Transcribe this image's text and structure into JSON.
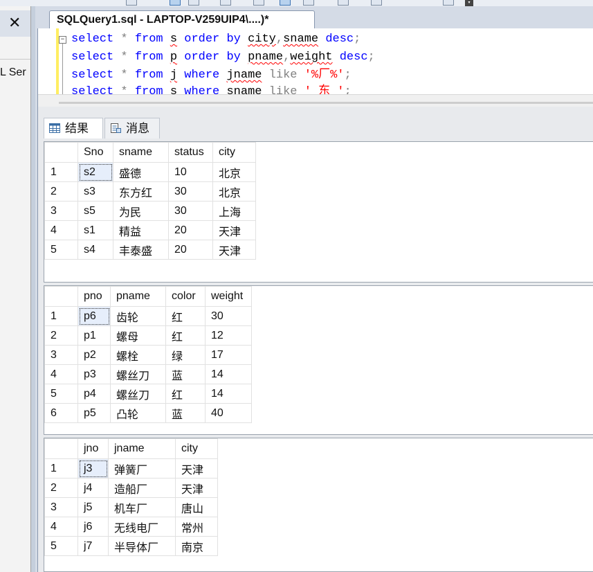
{
  "document": {
    "tab_title": "SQLQuery1.sql - LAPTOP-V259UIP4\\....)*"
  },
  "left_panel": {
    "close_glyph": "✕",
    "label": "L Ser"
  },
  "editor": {
    "fold_glyph": "−",
    "lines": [
      [
        {
          "t": "select",
          "c": "kw"
        },
        {
          "t": " ",
          "c": ""
        },
        {
          "t": "*",
          "c": "op"
        },
        {
          "t": " ",
          "c": ""
        },
        {
          "t": "from",
          "c": "kw"
        },
        {
          "t": " ",
          "c": ""
        },
        {
          "t": "s",
          "c": "sq"
        },
        {
          "t": " ",
          "c": ""
        },
        {
          "t": "order by",
          "c": "kw"
        },
        {
          "t": " ",
          "c": ""
        },
        {
          "t": "city",
          "c": "sq"
        },
        {
          "t": ",",
          "c": "op"
        },
        {
          "t": "sname",
          "c": "sq"
        },
        {
          "t": " ",
          "c": ""
        },
        {
          "t": "desc",
          "c": "kw"
        },
        {
          "t": ";",
          "c": "op"
        }
      ],
      [
        {
          "t": "select",
          "c": "kw"
        },
        {
          "t": " ",
          "c": ""
        },
        {
          "t": "*",
          "c": "op"
        },
        {
          "t": " ",
          "c": ""
        },
        {
          "t": "from",
          "c": "kw"
        },
        {
          "t": " ",
          "c": ""
        },
        {
          "t": "p",
          "c": "sq"
        },
        {
          "t": " ",
          "c": ""
        },
        {
          "t": "order by",
          "c": "kw"
        },
        {
          "t": " ",
          "c": ""
        },
        {
          "t": "pname",
          "c": "sq"
        },
        {
          "t": ",",
          "c": "op"
        },
        {
          "t": "weight",
          "c": "sq"
        },
        {
          "t": " ",
          "c": ""
        },
        {
          "t": "desc",
          "c": "kw"
        },
        {
          "t": ";",
          "c": "op"
        }
      ],
      [
        {
          "t": "select",
          "c": "kw"
        },
        {
          "t": " ",
          "c": ""
        },
        {
          "t": "*",
          "c": "op"
        },
        {
          "t": " ",
          "c": ""
        },
        {
          "t": "from",
          "c": "kw"
        },
        {
          "t": " ",
          "c": ""
        },
        {
          "t": "j",
          "c": "sq"
        },
        {
          "t": " ",
          "c": ""
        },
        {
          "t": "where",
          "c": "kw"
        },
        {
          "t": " ",
          "c": ""
        },
        {
          "t": "jname",
          "c": "sq"
        },
        {
          "t": " ",
          "c": ""
        },
        {
          "t": "like",
          "c": "op"
        },
        {
          "t": " ",
          "c": ""
        },
        {
          "t": "'%厂%'",
          "c": "str"
        },
        {
          "t": ";",
          "c": "op"
        }
      ],
      [
        {
          "t": "select",
          "c": "kw"
        },
        {
          "t": " ",
          "c": ""
        },
        {
          "t": "*",
          "c": "op"
        },
        {
          "t": " ",
          "c": ""
        },
        {
          "t": "from",
          "c": "kw"
        },
        {
          "t": " ",
          "c": ""
        },
        {
          "t": "s",
          "c": "sq"
        },
        {
          "t": " ",
          "c": ""
        },
        {
          "t": "where",
          "c": "kw"
        },
        {
          "t": " ",
          "c": ""
        },
        {
          "t": "sname",
          "c": "sq"
        },
        {
          "t": " ",
          "c": ""
        },
        {
          "t": "like",
          "c": "op"
        },
        {
          "t": " ",
          "c": ""
        },
        {
          "t": "'_东_'",
          "c": "str"
        },
        {
          "t": ";",
          "c": "op"
        }
      ]
    ]
  },
  "results": {
    "tabs": [
      {
        "label": "结果",
        "icon": "grid-icon"
      },
      {
        "label": "消息",
        "icon": "messages-icon"
      }
    ],
    "grids": [
      {
        "columns": [
          "Sno",
          "sname",
          "status",
          "city"
        ],
        "rows": [
          [
            "1",
            "s2",
            "盛德",
            "10",
            "北京"
          ],
          [
            "2",
            "s3",
            "东方红",
            "30",
            "北京"
          ],
          [
            "3",
            "s5",
            "为民",
            "30",
            "上海"
          ],
          [
            "4",
            "s1",
            "精益",
            "20",
            "天津"
          ],
          [
            "5",
            "s4",
            "丰泰盛",
            "20",
            "天津"
          ]
        ]
      },
      {
        "columns": [
          "pno",
          "pname",
          "color",
          "weight"
        ],
        "rows": [
          [
            "1",
            "p6",
            "齿轮",
            "红",
            "30"
          ],
          [
            "2",
            "p1",
            "螺母",
            "红",
            "12"
          ],
          [
            "3",
            "p2",
            "螺栓",
            "绿",
            "17"
          ],
          [
            "4",
            "p3",
            "螺丝刀",
            "蓝",
            "14"
          ],
          [
            "5",
            "p4",
            "螺丝刀",
            "红",
            "14"
          ],
          [
            "6",
            "p5",
            "凸轮",
            "蓝",
            "40"
          ]
        ]
      },
      {
        "columns": [
          "jno",
          "jname",
          "city"
        ],
        "rows": [
          [
            "1",
            "j3",
            "弹簧厂",
            "天津"
          ],
          [
            "2",
            "j4",
            "造船厂",
            "天津"
          ],
          [
            "3",
            "j5",
            "机车厂",
            "唐山"
          ],
          [
            "4",
            "j6",
            "无线电厂",
            "常州"
          ],
          [
            "5",
            "j7",
            "半导体厂",
            "南京"
          ]
        ]
      }
    ]
  }
}
